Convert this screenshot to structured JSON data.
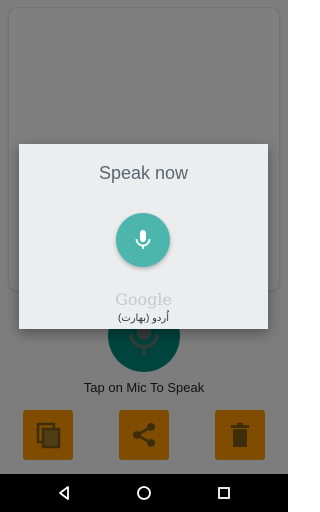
{
  "main": {
    "hint_text": "Tap on Mic To Speak",
    "actions": [
      {
        "icon": "copy-icon"
      },
      {
        "icon": "share-icon"
      },
      {
        "icon": "delete-icon"
      }
    ]
  },
  "dialog": {
    "title": "Speak now",
    "mic_icon": "mic-icon",
    "brand": "Google",
    "language": "اُردو (بھارت)"
  },
  "colors": {
    "accent_orange": "#ff9800",
    "mic_green": "#00897b",
    "dialog_mic": "#4db6ac"
  },
  "navbar": {
    "icons": [
      "back-icon",
      "home-icon",
      "recents-icon"
    ]
  }
}
